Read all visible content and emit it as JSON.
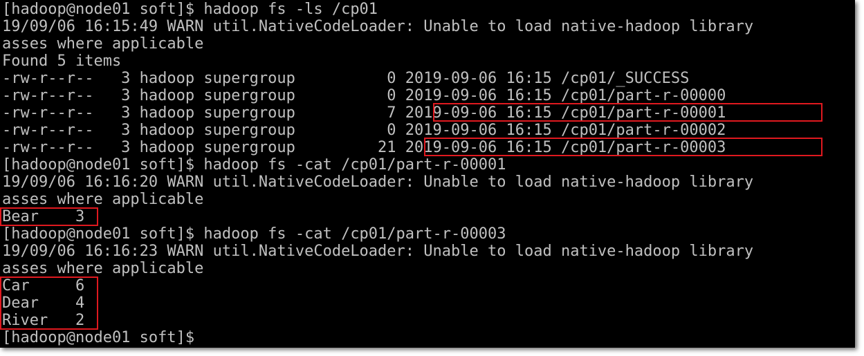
{
  "terminal": {
    "lines": [
      "[hadoop@node01 soft]$ hadoop fs -ls /cp01",
      "19/09/06 16:15:49 WARN util.NativeCodeLoader: Unable to load native-hadoop library",
      "asses where applicable",
      "Found 5 items",
      "-rw-r--r--   3 hadoop supergroup          0 2019-09-06 16:15 /cp01/_SUCCESS",
      "-rw-r--r--   3 hadoop supergroup          0 2019-09-06 16:15 /cp01/part-r-00000",
      "-rw-r--r--   3 hadoop supergroup          7 2019-09-06 16:15 /cp01/part-r-00001",
      "-rw-r--r--   3 hadoop supergroup          0 2019-09-06 16:15 /cp01/part-r-00002",
      "-rw-r--r--   3 hadoop supergroup         21 2019-09-06 16:15 /cp01/part-r-00003",
      "[hadoop@node01 soft]$ hadoop fs -cat /cp01/part-r-00001",
      "19/09/06 16:16:20 WARN util.NativeCodeLoader: Unable to load native-hadoop library",
      "asses where applicable",
      "Bear    3",
      "[hadoop@node01 soft]$ hadoop fs -cat /cp01/part-r-00003",
      "19/09/06 16:16:23 WARN util.NativeCodeLoader: Unable to load native-hadoop library",
      "asses where applicable",
      "Car     6",
      "Dear    4",
      "River   2",
      "[hadoop@node01 soft]$"
    ],
    "colors": {
      "background": "#000000",
      "text": "#c0c0c0",
      "highlight_border": "#e0191f"
    }
  }
}
